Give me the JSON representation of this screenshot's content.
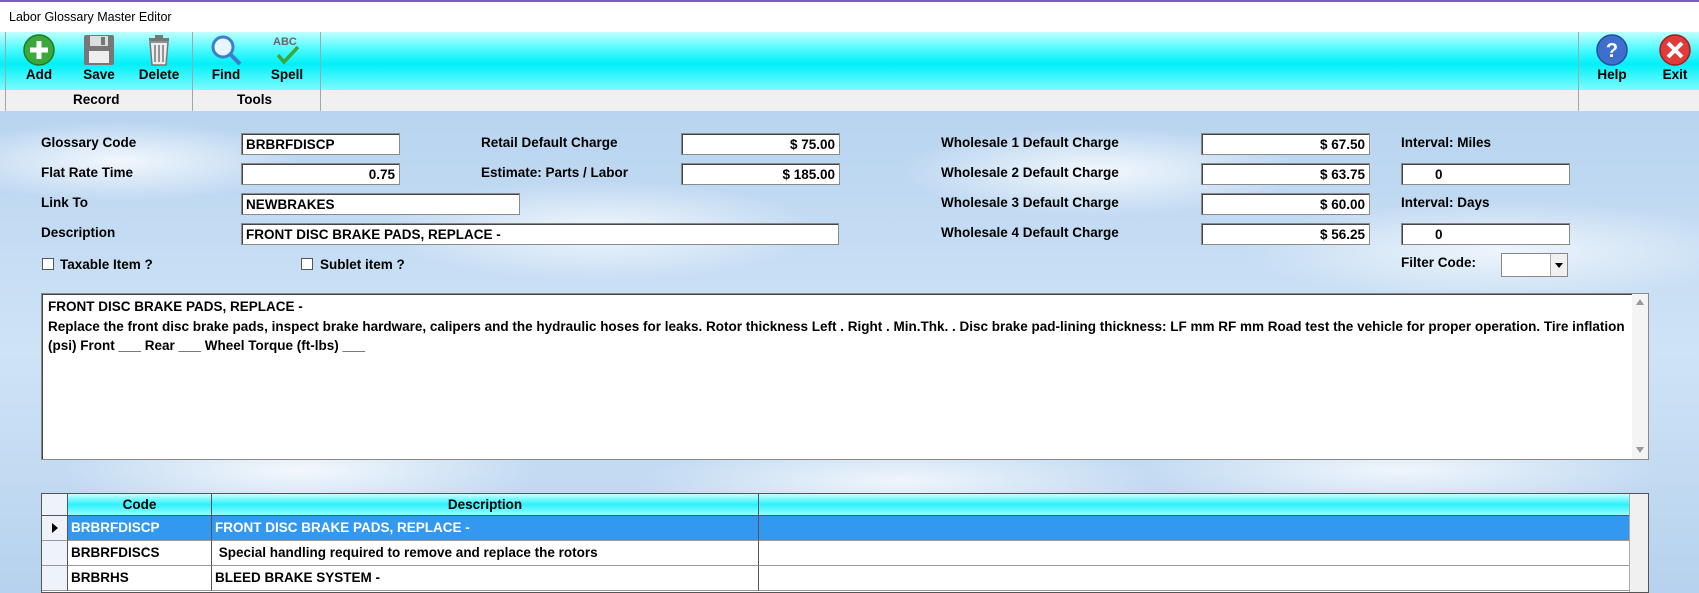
{
  "window": {
    "title": "Labor Glossary Master Editor"
  },
  "toolbar": {
    "add": "Add",
    "save": "Save",
    "delete": "Delete",
    "find": "Find",
    "spell": "Spell",
    "help": "Help",
    "exit": "Exit",
    "group_record": "Record",
    "group_tools": "Tools",
    "spell_icon_text": "ABC"
  },
  "form": {
    "glossary_code_label": "Glossary Code",
    "glossary_code": "BRBRFDISCP",
    "flat_rate_label": "Flat Rate Time",
    "flat_rate": "0.75",
    "link_to_label": "Link To",
    "link_to": "NEWBRAKES",
    "description_label": "Description",
    "description": "FRONT DISC BRAKE PADS, REPLACE -",
    "taxable_label": "Taxable Item ?",
    "sublet_label": "Sublet item ?",
    "retail_label": "Retail Default Charge",
    "retail": "$  75.00",
    "estimate_label": "Estimate: Parts / Labor",
    "estimate": "$ 185.00",
    "w1_label": "Wholesale 1 Default Charge",
    "w1": "$  67.50",
    "w2_label": "Wholesale 2 Default Charge",
    "w2": "$  63.75",
    "w3_label": "Wholesale 3 Default Charge",
    "w3": "$  60.00",
    "w4_label": "Wholesale 4 Default Charge",
    "w4": "$  56.25",
    "interval_miles_label": "Interval: Miles",
    "interval_miles": "0",
    "interval_days_label": "Interval: Days",
    "interval_days": "0",
    "filter_label": "Filter Code:"
  },
  "memo": {
    "line1": "FRONT DISC BRAKE PADS, REPLACE -",
    "line2": "Replace the front disc brake pads, inspect brake hardware, calipers and the hydraulic hoses for leaks.   Rotor thickness Left   .     Right   .     Min.Thk.   .     Disc brake pad-lining thickness: LF      mm    RF      mm   Road test the vehicle for proper operation.  Tire inflation (psi) Front ___ Rear ___ Wheel Torque (ft-lbs) ___"
  },
  "grid": {
    "headers": [
      "Code",
      "Description"
    ],
    "rows": [
      {
        "code": "BRBRFDISCP",
        "desc": "FRONT DISC BRAKE PADS, REPLACE -"
      },
      {
        "code": "BRBRFDISCS",
        "desc": " Special handling required to remove and replace the rotors"
      },
      {
        "code": "BRBRHS",
        "desc": "BLEED BRAKE SYSTEM -"
      }
    ]
  }
}
